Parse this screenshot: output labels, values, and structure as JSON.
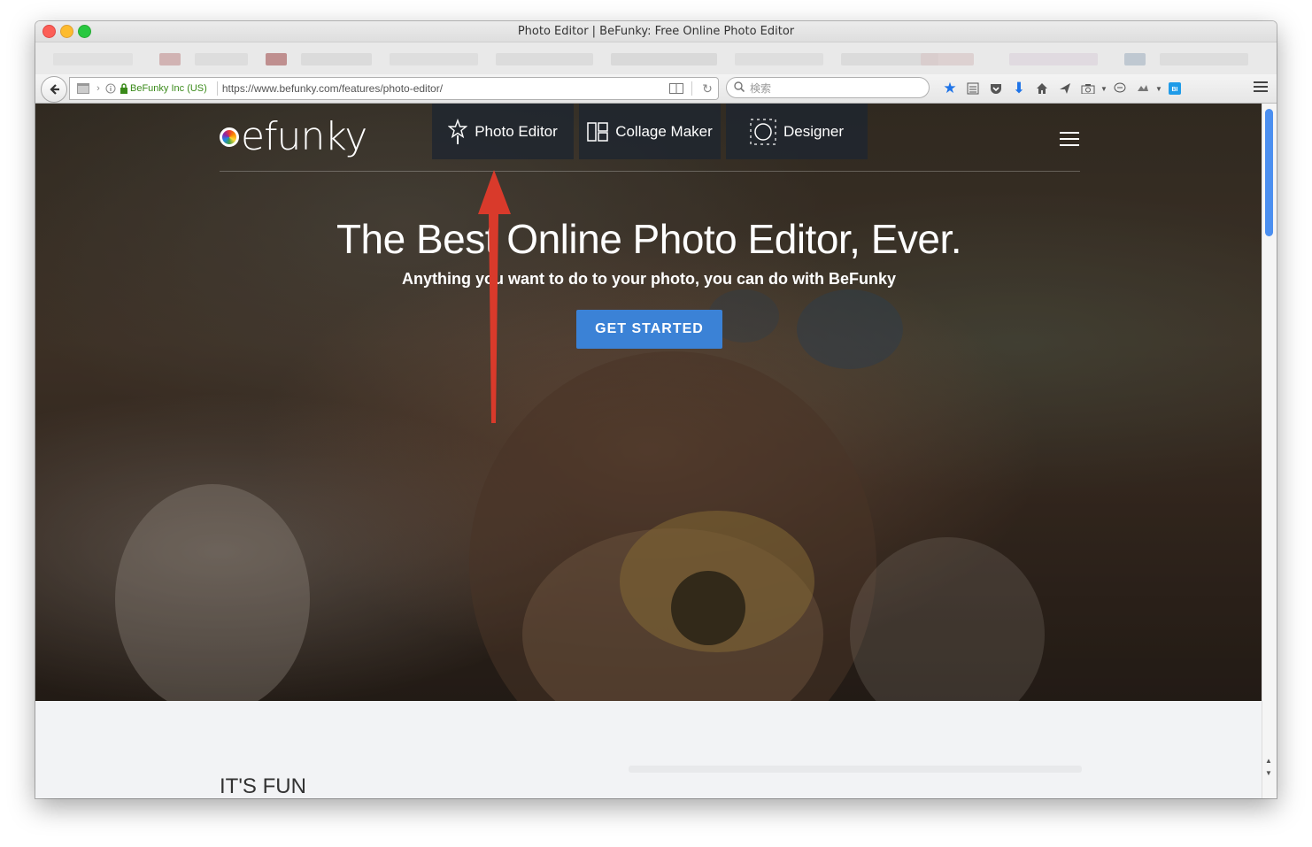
{
  "window": {
    "title": "Photo Editor | BeFunky: Free Online Photo Editor"
  },
  "browser": {
    "identity_label": "BeFunky Inc (US)",
    "url": "https://www.befunky.com/features/photo-editor/",
    "search_placeholder": "検索"
  },
  "site": {
    "logo_text": "efunky",
    "nav": [
      {
        "label": "Photo Editor",
        "icon": "star-wand-icon"
      },
      {
        "label": "Collage Maker",
        "icon": "collage-grid-icon"
      },
      {
        "label": "Designer",
        "icon": "designer-circle-icon"
      }
    ],
    "headline": "The Best Online Photo Editor, Ever.",
    "subline": "Anything you want to do to your photo, you can do with BeFunky",
    "cta_label": "GET STARTED",
    "section_title": "IT'S FUN"
  },
  "colors": {
    "cta": "#3b82d6",
    "nav_tab_bg": "#1e2630",
    "identity_green": "#3a8a1a",
    "scroll_thumb": "#4b8ff0",
    "annotation_arrow": "#d93a2b"
  }
}
